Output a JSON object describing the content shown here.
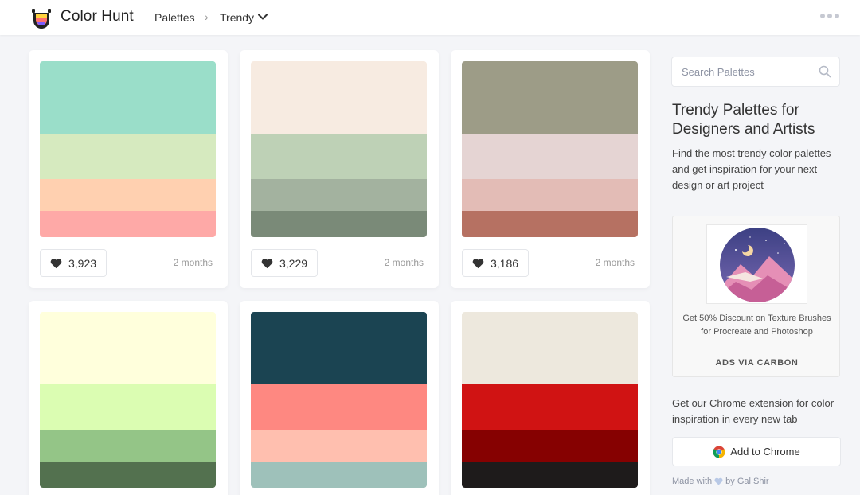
{
  "header": {
    "brand": "Color Hunt",
    "nav": {
      "palettes": "Palettes",
      "separator": ">",
      "trendy": "Trendy"
    },
    "icons": {
      "logo": "color-hunt-logo-icon",
      "chevron": "chevron-down-icon",
      "more": "more-dots-icon"
    }
  },
  "palettes": [
    {
      "colors": [
        "#9adec9",
        "#d6eabf",
        "#ffd0b0",
        "#fea9a7"
      ],
      "likes": "3,923",
      "age": "2 months"
    },
    {
      "colors": [
        "#f7ebe1",
        "#bed1b6",
        "#a3b29f",
        "#7a8a78"
      ],
      "likes": "3,229",
      "age": "2 months"
    },
    {
      "colors": [
        "#9d9c87",
        "#e5d4d3",
        "#e3bcb6",
        "#b67162"
      ],
      "likes": "3,186",
      "age": "2 months"
    },
    {
      "colors": [
        "#ffffdc",
        "#dbfdb2",
        "#94c587",
        "#53714f"
      ],
      "likes": "",
      "age": ""
    },
    {
      "colors": [
        "#1b4452",
        "#fe8881",
        "#ffbfaf",
        "#9ec1ba"
      ],
      "likes": "",
      "age": ""
    },
    {
      "colors": [
        "#ede8dd",
        "#d01313",
        "#860101",
        "#1e1b1b"
      ],
      "likes": "",
      "age": ""
    }
  ],
  "sidebar": {
    "search_placeholder": "Search Palettes",
    "title": "Trendy Palettes for Designers and Artists",
    "description": "Find the most trendy color palettes and get inspiration for your next design or art project",
    "ad": {
      "text": "Get 50% Discount on Texture Brushes for Procreate and Photoshop",
      "via": "ADS VIA CARBON"
    },
    "extension_text": "Get our Chrome extension for color inspiration in every new tab",
    "chrome_button": "Add to Chrome",
    "made_with_prefix": "Made with",
    "made_with_suffix": "by Gal Shir"
  },
  "colors": {
    "accent_heart": "#333333",
    "muted_text": "#999999"
  }
}
